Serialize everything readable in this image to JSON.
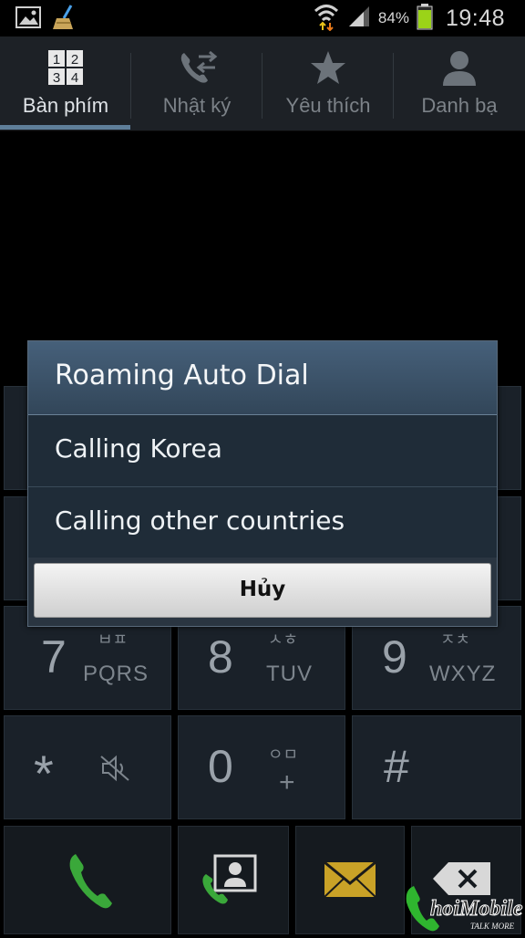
{
  "status_bar": {
    "battery_percent": "84%",
    "time": "19:48",
    "icons": [
      "gallery-icon",
      "cleaner-icon",
      "wifi-icon",
      "signal-icon",
      "battery-icon"
    ]
  },
  "tabs": [
    {
      "label": "Bàn phím",
      "icon": "dialpad-icon",
      "active": true
    },
    {
      "label": "Nhật ký",
      "icon": "call-log-icon",
      "active": false
    },
    {
      "label": "Yêu thích",
      "icon": "star-icon",
      "active": false
    },
    {
      "label": "Danh bạ",
      "icon": "contact-icon",
      "active": false
    }
  ],
  "dialpad_tab_digits": [
    "1",
    "2",
    "3",
    "4"
  ],
  "keypad": {
    "k7": {
      "digit": "7",
      "letters": "PQRS",
      "korean": "ㅂㅍ"
    },
    "k8": {
      "digit": "8",
      "letters": "TUV",
      "korean": "ㅅㅎ"
    },
    "k9": {
      "digit": "9",
      "letters": "WXYZ",
      "korean": "ㅈㅊ"
    },
    "kstar": {
      "digit": "*"
    },
    "k0": {
      "digit": "0",
      "letters": "+",
      "korean": "ㅇㅁ"
    },
    "khash": {
      "digit": "#"
    }
  },
  "bottom_row": [
    "call-icon",
    "video-call-icon",
    "message-icon",
    "backspace-icon"
  ],
  "dialog": {
    "title": "Roaming Auto Dial",
    "options": [
      "Calling Korea",
      "Calling other countries"
    ],
    "cancel_label": "Hủy"
  },
  "watermark": {
    "brand": "hoiMobile",
    "tagline": "TALK MORE"
  },
  "colors": {
    "tab_active_underline": "#5e7e99",
    "dialog_title_bg": "#3d546b",
    "call_green": "#3aa83a",
    "message_yellow": "#c9a227"
  }
}
